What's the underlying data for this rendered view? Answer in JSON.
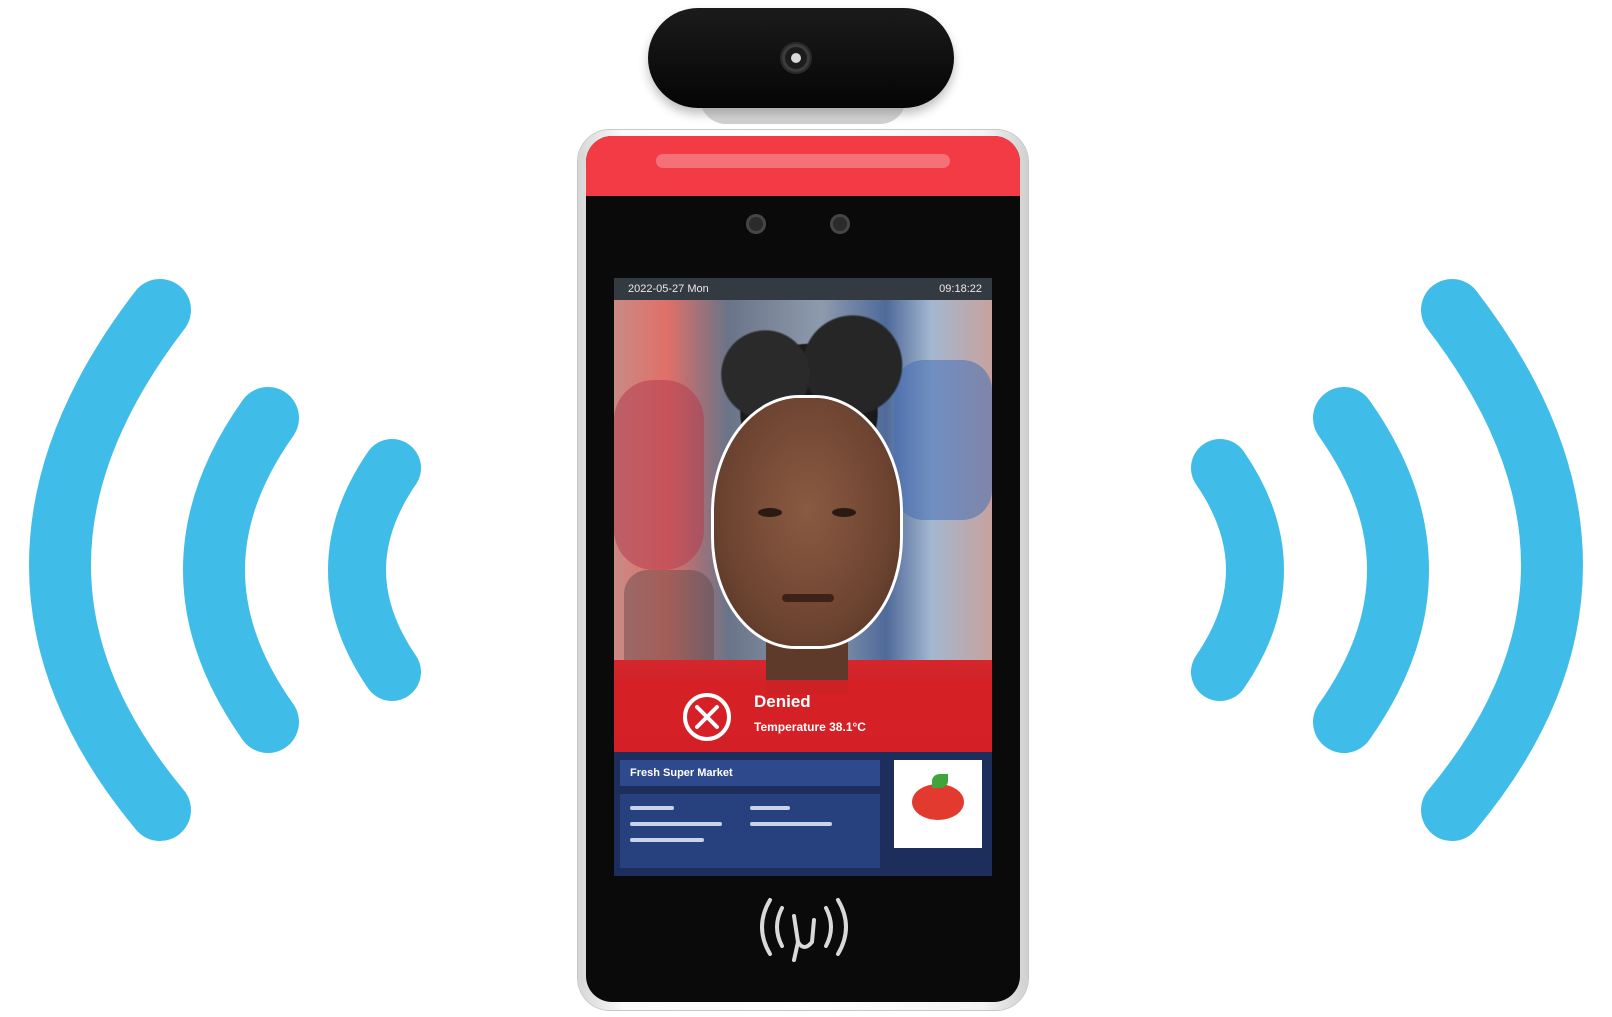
{
  "screen": {
    "status_date": "2022-05-27 Mon",
    "status_time": "09:18:22",
    "alert": {
      "title": "Denied",
      "detail": "Temperature 38.1°C",
      "icon": "deny-x-icon",
      "color": "#d62026"
    },
    "shop_name": "Fresh Super Market",
    "logo": "store-logo"
  },
  "device": {
    "led_color": "#f23b44",
    "nfc_icon": "nfc-reader-icon"
  },
  "waves": {
    "color": "#3fbde8",
    "icon": "wireless-signal-icon"
  }
}
